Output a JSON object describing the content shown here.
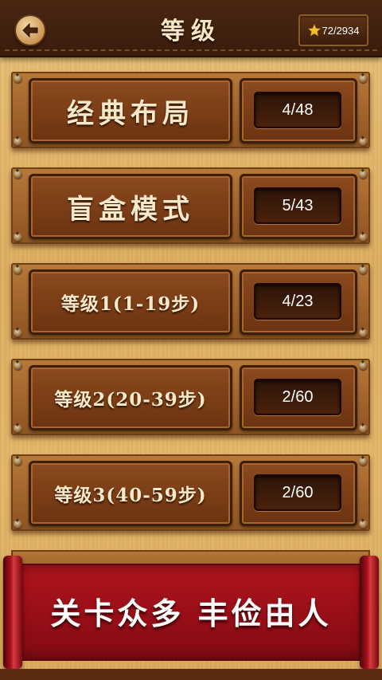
{
  "header": {
    "title": "等级",
    "stars": "72/2934"
  },
  "levels": [
    {
      "name": "经典布局",
      "progress": "4/48"
    },
    {
      "name": "盲盒模式",
      "progress": "5/43"
    },
    {
      "name": "等级1(1-19步)",
      "progress": "4/23"
    },
    {
      "name": "等级2(20-39步)",
      "progress": "2/60"
    },
    {
      "name": "等级3(40-59步)",
      "progress": "2/60"
    }
  ],
  "banner": {
    "slogan": "关卡众多 丰俭由人"
  },
  "colors": {
    "header": "#3a1c0c",
    "plate": "#7a3d16",
    "banner": "#9a0f18",
    "star": "#f2c230"
  },
  "icons": {
    "back": "back-arrow-icon",
    "star": "star-icon",
    "bolt": "bolt-icon"
  }
}
